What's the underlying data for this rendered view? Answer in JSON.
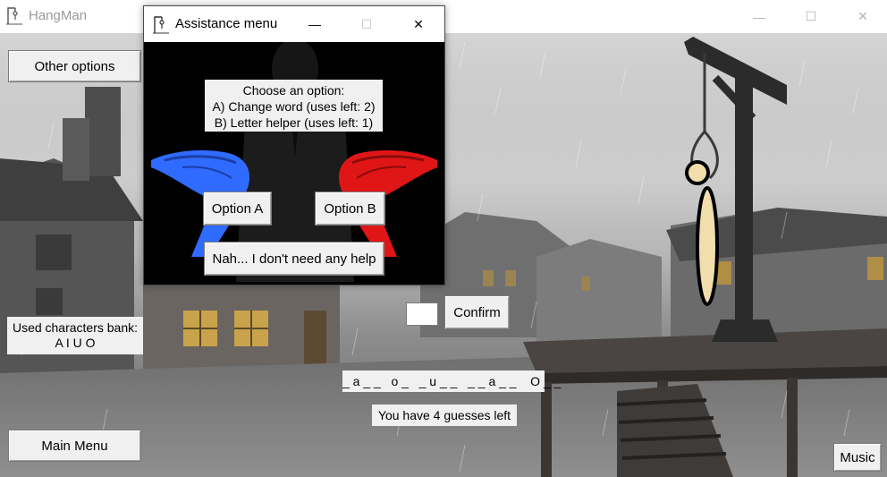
{
  "window": {
    "title": "HangMan",
    "minimize_glyph": "—",
    "maximize_glyph": "☐",
    "close_glyph": "✕"
  },
  "main": {
    "other_options_label": "Other options",
    "used_chars_title": "Used characters bank:",
    "used_chars_value": "A I U O",
    "guess_input_value": "",
    "confirm_label": "Confirm",
    "word_pattern": "_ a _ _   o _   _ u _ _   _ _ a _ _    O _ _",
    "guesses_left_text": "You have 4 guesses left",
    "main_menu_label": "Main Menu",
    "music_label": "Music"
  },
  "dialog": {
    "title": "Assistance menu",
    "minimize_glyph": "—",
    "maximize_glyph": "☐",
    "close_glyph": "✕",
    "prompt_line1": "Choose an option:",
    "prompt_line2": "A) Change word (uses left: 2)",
    "prompt_line3": "B) Letter helper (uses left: 1)",
    "option_a_label": "Option A",
    "option_b_label": "Option B",
    "no_help_label": "Nah... I don't need any help"
  },
  "colors": {
    "hand_left": "#2f6bff",
    "hand_right": "#e01616",
    "hangman_body": "#f2deac",
    "rope": "#3a3a3a",
    "gallows": "#2b2b2b"
  }
}
